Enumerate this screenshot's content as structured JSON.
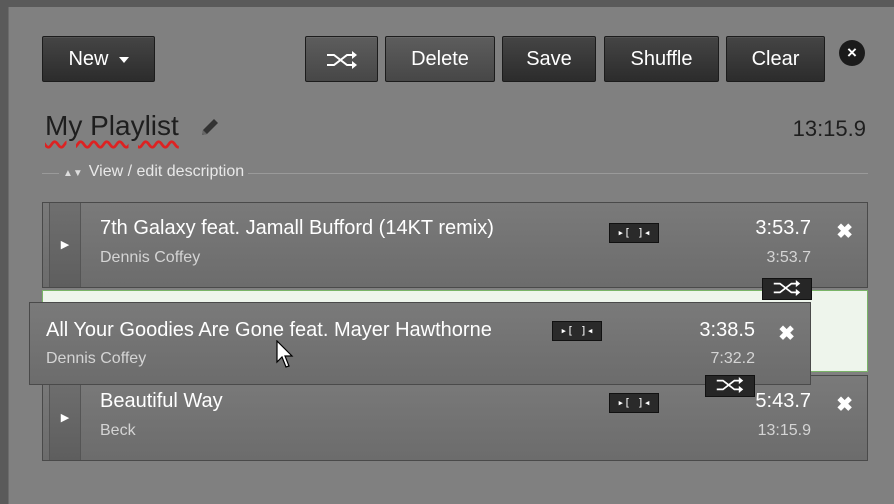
{
  "toolbar": {
    "new_label": "New",
    "delete_label": "Delete",
    "save_label": "Save",
    "shuffle_label": "Shuffle",
    "clear_label": "Clear",
    "close_label": "×"
  },
  "playlist": {
    "title": "My Playlist",
    "total_duration": "13:15.9",
    "description_toggle": "View / edit description"
  },
  "tracks": [
    {
      "title": "7th Galaxy feat. Jamall Bufford (14KT remix)",
      "artist": "Dennis Coffey",
      "duration": "3:53.7",
      "cumulative": "3:53.7",
      "cue": "▸[ ]◂"
    },
    {
      "title": "All Your Goodies Are Gone feat. Mayer Hawthorne",
      "artist": "Dennis Coffey",
      "duration": "3:38.5",
      "cumulative": "7:32.2",
      "cue": "▸[ ]◂"
    },
    {
      "title": "Beautiful Way",
      "artist": "Beck",
      "duration": "5:43.7",
      "cumulative": "13:15.9",
      "cue": "▸[ ]◂"
    }
  ],
  "icons": {
    "remove": "✖",
    "play": "▶"
  }
}
